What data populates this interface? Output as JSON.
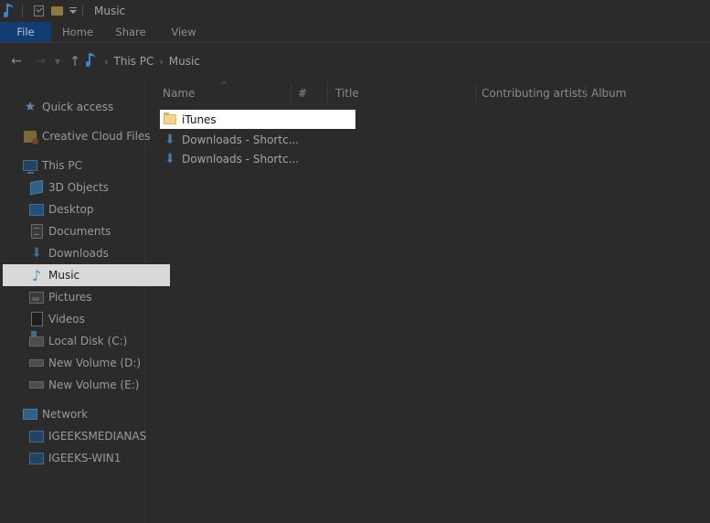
{
  "window": {
    "title": "Music"
  },
  "ribbon": {
    "tabs": [
      "File",
      "Home",
      "Share",
      "View"
    ]
  },
  "address": {
    "crumbs": [
      "This PC",
      "Music"
    ]
  },
  "navigation": {
    "quick_access": "Quick access",
    "creative_cloud": "Creative Cloud Files",
    "this_pc": "This PC",
    "items": [
      "3D Objects",
      "Desktop",
      "Documents",
      "Downloads",
      "Music",
      "Pictures",
      "Videos",
      "Local Disk (C:)",
      "New Volume (D:)",
      "New Volume (E:)"
    ],
    "selected": "Music",
    "network": "Network",
    "network_items": [
      "IGEEKSMEDIANAS",
      "IGEEKS-WIN1"
    ]
  },
  "columns": [
    "Name",
    "#",
    "Title",
    "Contributing artists",
    "Album"
  ],
  "files": [
    {
      "name": "iTunes",
      "type": "folder",
      "highlighted": true
    },
    {
      "name": "Downloads - Shortc...",
      "type": "shortcut",
      "highlighted": false
    },
    {
      "name": "Downloads - Shortc...",
      "type": "shortcut",
      "highlighted": false
    }
  ],
  "icons": {
    "app": "music-note-icon",
    "quick_access": "star-icon",
    "creative_cloud": "creative-cloud-icon",
    "this_pc": "pc-icon",
    "network": "network-icon"
  },
  "colors": {
    "background": "#2b2b2b",
    "file_tab": "#113d72",
    "selected_nav": "#d9d9d9",
    "highlight_row": "#ffffff",
    "folder": "#f2d68a"
  }
}
